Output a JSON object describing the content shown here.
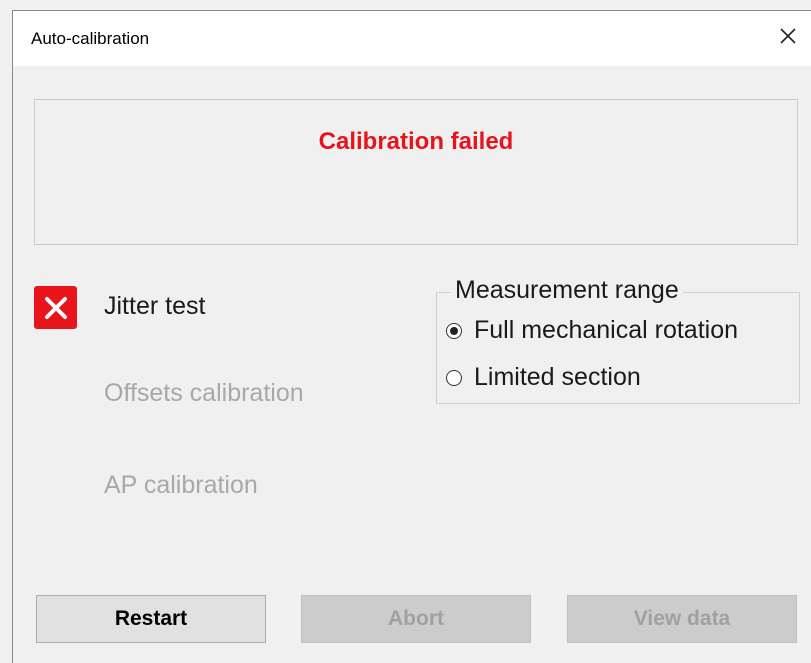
{
  "window": {
    "title": "Auto-calibration",
    "close_glyph": "✕"
  },
  "status": {
    "message": "Calibration failed",
    "color": "#e8141c"
  },
  "steps": [
    {
      "label": "Jitter test",
      "state": "failed",
      "icon": "x-mark-icon"
    },
    {
      "label": "Offsets calibration",
      "state": "pending"
    },
    {
      "label": "AP calibration",
      "state": "pending"
    }
  ],
  "measurement_range": {
    "legend": "Measurement range",
    "options": [
      {
        "label": "Full mechanical rotation",
        "selected": true
      },
      {
        "label": "Limited section",
        "selected": false
      }
    ]
  },
  "buttons": {
    "restart": {
      "label": "Restart",
      "enabled": true
    },
    "abort": {
      "label": "Abort",
      "enabled": false
    },
    "view_data": {
      "label": "View data",
      "enabled": false
    }
  }
}
